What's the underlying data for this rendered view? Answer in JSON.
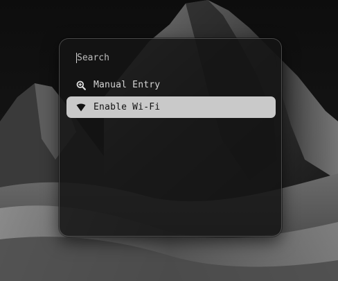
{
  "launcher": {
    "search": {
      "placeholder": "Search",
      "value": ""
    },
    "items": [
      {
        "label": "Manual Entry",
        "icon": "zoom-in-icon",
        "selected": false
      },
      {
        "label": "Enable Wi-Fi",
        "icon": "wifi-icon",
        "selected": true
      }
    ]
  },
  "colors": {
    "selected_bg": "#c9c9c9",
    "panel_bg": "#141414",
    "text": "#d6d6d6"
  }
}
